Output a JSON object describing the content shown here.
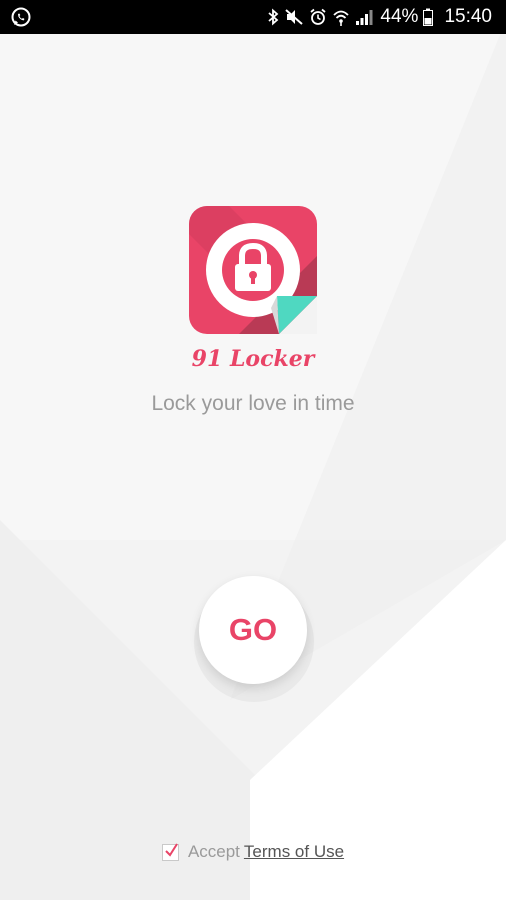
{
  "status_bar": {
    "battery": "44%",
    "time": "15:40",
    "icons": [
      "whatsapp-icon",
      "bluetooth-icon",
      "mute-icon",
      "alarm-icon",
      "wifi-icon",
      "signal-icon",
      "battery-icon"
    ]
  },
  "app": {
    "name": "91 Locker",
    "tagline": "Lock your love in time",
    "logo_icon": "padlock-icon"
  },
  "go_button": {
    "label": "GO"
  },
  "terms": {
    "accept_label": "Accept",
    "link_label": "Terms of Use",
    "checked": true
  },
  "colors": {
    "accent": "#e94467",
    "logo_dark": "#b93a55",
    "logo_teal": "#4fd8c1",
    "text_gray": "#9a9a9a",
    "background": "#f5f5f5"
  }
}
